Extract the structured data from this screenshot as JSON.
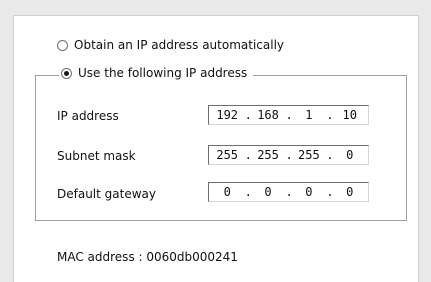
{
  "options": {
    "auto_label": "Obtain an IP address automatically",
    "manual_label": "Use the following IP address"
  },
  "fields": {
    "ip_label": "IP address",
    "subnet_label": "Subnet mask",
    "gateway_label": "Default gateway"
  },
  "ip": {
    "o1": "192",
    "o2": "168",
    "o3": "1",
    "o4": "10"
  },
  "subnet": {
    "o1": "255",
    "o2": "255",
    "o3": "255",
    "o4": "0"
  },
  "gateway": {
    "o1": "0",
    "o2": "0",
    "o3": "0",
    "o4": "0"
  },
  "separator": ".",
  "mac": "MAC address : 0060db000241"
}
